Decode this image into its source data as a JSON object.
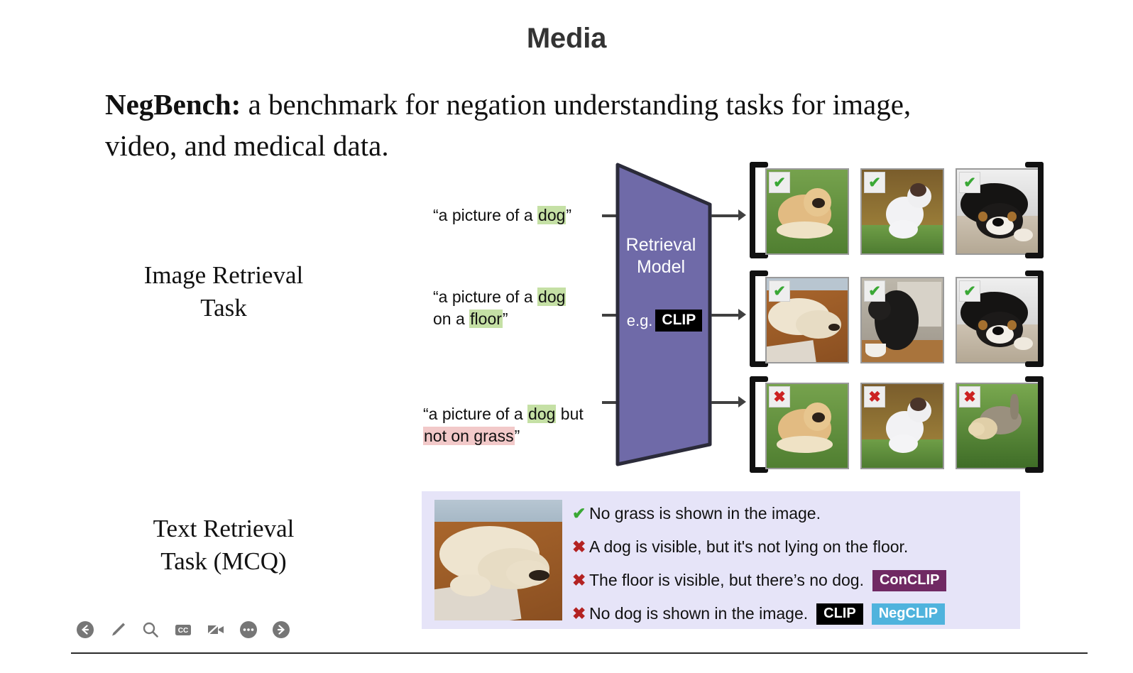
{
  "slide": {
    "title": "Media",
    "headline_bold": "NegBench:",
    "headline_rest": " a benchmark for negation understanding tasks for image, video, and medical data."
  },
  "tasks": {
    "image_retrieval_label": "Image Retrieval\nTask",
    "text_retrieval_label": "Text Retrieval\nTask (MCQ)"
  },
  "model": {
    "name_line1": "Retrieval",
    "name_line2": "Model",
    "eg_label": "e.g.",
    "eg_chip": "CLIP",
    "fill_color": "#6f6aa8",
    "stroke_color": "#2b2b3a"
  },
  "queries": [
    {
      "id": "query-0",
      "parts": [
        {
          "text": "“a picture of a ",
          "highlight": "none"
        },
        {
          "text": "dog",
          "highlight": "green"
        },
        {
          "text": "”",
          "highlight": "none"
        }
      ]
    },
    {
      "id": "query-1",
      "parts": [
        {
          "text": "“a picture of a ",
          "highlight": "none"
        },
        {
          "text": "dog",
          "highlight": "green"
        },
        {
          "text": " on a ",
          "highlight": "none"
        },
        {
          "text": "floor",
          "highlight": "green"
        },
        {
          "text": "”",
          "highlight": "none"
        }
      ]
    },
    {
      "id": "query-2",
      "parts": [
        {
          "text": "“a picture of a ",
          "highlight": "none"
        },
        {
          "text": "dog",
          "highlight": "green"
        },
        {
          "text": " but ",
          "highlight": "none"
        },
        {
          "text": "not on grass",
          "highlight": "pink"
        },
        {
          "text": "”",
          "highlight": "none"
        }
      ]
    }
  ],
  "highlight_colors": {
    "green": "#c5e0a5",
    "pink": "#f2c9c9"
  },
  "result_rows": [
    {
      "row_id": "row-0",
      "query_ref": "query-0",
      "cards": [
        {
          "badge": "check",
          "caption": "golden retriever lying on grass"
        },
        {
          "badge": "check",
          "caption": "jack russell terrier sitting on grass"
        },
        {
          "badge": "check",
          "caption": "black and tan dog lying on floor"
        }
      ]
    },
    {
      "row_id": "row-1",
      "query_ref": "query-1",
      "cards": [
        {
          "badge": "check",
          "caption": "cream retriever lying on wooden floor"
        },
        {
          "badge": "check",
          "caption": "black curly dog sitting in kitchen"
        },
        {
          "badge": "check",
          "caption": "black and tan dog lying on floor"
        }
      ]
    },
    {
      "row_id": "row-2",
      "query_ref": "query-2",
      "cards": [
        {
          "badge": "cross",
          "caption": "golden retriever lying on grass"
        },
        {
          "badge": "cross",
          "caption": "jack russell terrier sitting on grass"
        },
        {
          "badge": "cross",
          "caption": "tan dog walking on grass"
        }
      ]
    }
  ],
  "badge_glyphs": {
    "check": "✔",
    "cross": "✖"
  },
  "mcq": {
    "image_caption": "cream golden retriever lying on a wooden floor",
    "panel_color": "#e6e4f8",
    "options": [
      {
        "mark": "check",
        "text": "No grass is shown in the image.",
        "chips": []
      },
      {
        "mark": "cross",
        "text": "A dog is visible, but it's not lying on the floor.",
        "chips": []
      },
      {
        "mark": "cross",
        "text": "The floor is visible, but there’s no dog.",
        "chips": [
          {
            "label": "ConCLIP",
            "color": "#702963"
          }
        ]
      },
      {
        "mark": "cross",
        "text": "No dog is shown in the image.",
        "chips": [
          {
            "label": "CLIP",
            "color": "#000000"
          },
          {
            "label": "NegCLIP",
            "color": "#4fb3dd"
          }
        ]
      }
    ]
  },
  "toolbar": {
    "items": [
      {
        "name": "back-arrow-icon",
        "label": "Back"
      },
      {
        "name": "pen-icon",
        "label": "Draw"
      },
      {
        "name": "search-icon",
        "label": "Search"
      },
      {
        "name": "closed-captions-icon",
        "label": "CC"
      },
      {
        "name": "camera-off-icon",
        "label": "Camera off"
      },
      {
        "name": "more-options-icon",
        "label": "More options"
      },
      {
        "name": "forward-arrow-icon",
        "label": "Forward"
      }
    ]
  }
}
